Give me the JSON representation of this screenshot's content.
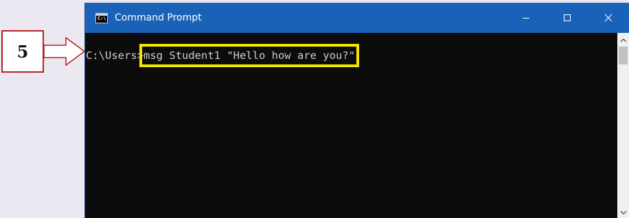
{
  "callout": {
    "step_number": "5",
    "border_color": "#b91c1c"
  },
  "window": {
    "title": "Command Prompt",
    "app_icon_text": "C:\\",
    "titlebar_color": "#1a62b7",
    "controls": {
      "minimize_icon": "minimize-icon",
      "maximize_icon": "maximize-icon",
      "close_icon": "close-icon"
    }
  },
  "console": {
    "prompt": "C:\\Users>",
    "command": "msg Student1 \"Hello how are you?\"",
    "text_color": "#cccccc",
    "highlight_color": "#f3e600"
  }
}
